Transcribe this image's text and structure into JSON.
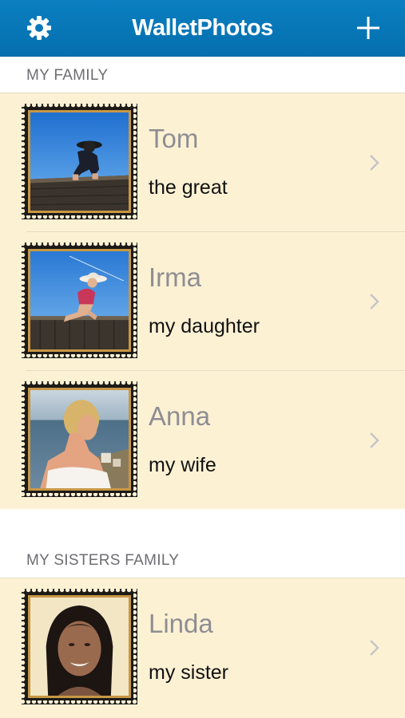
{
  "app": {
    "title": "WalletPhotos",
    "accent": "#0a7fc0",
    "row_background": "#fdf1d4"
  },
  "nav": {
    "left_icon": "gear-icon",
    "right_icon": "plus-icon"
  },
  "sections": [
    {
      "header": "MY FAMILY",
      "items": [
        {
          "name": "Tom",
          "subtitle": "the great",
          "photo": "child-on-rooftop-hat"
        },
        {
          "name": "Irma",
          "subtitle": "my daughter",
          "photo": "girl-in-cowboy-hat-on-rooftop"
        },
        {
          "name": "Anna",
          "subtitle": "my wife",
          "photo": "woman-by-sea"
        }
      ]
    },
    {
      "header": "MY SISTERS FAMILY",
      "items": [
        {
          "name": "Linda",
          "subtitle": "my sister",
          "photo": "smiling-woman-portrait"
        }
      ]
    }
  ]
}
